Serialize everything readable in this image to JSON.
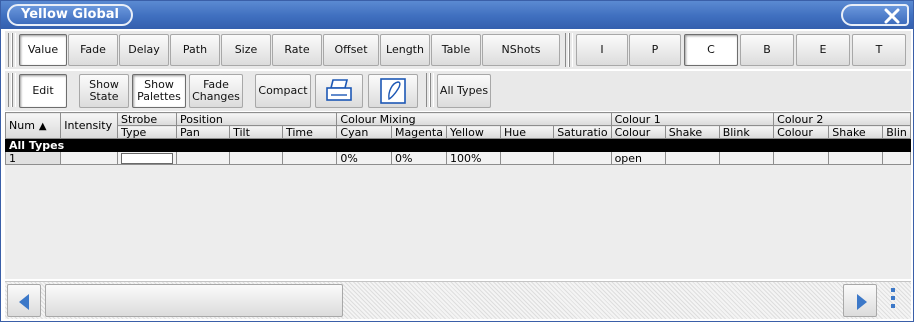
{
  "window": {
    "title": "Yellow Global"
  },
  "toolbar1": {
    "buttons": [
      "Value",
      "Fade",
      "Delay",
      "Path",
      "Size",
      "Rate",
      "Offset",
      "Length",
      "Table",
      "NShots"
    ],
    "attr_buttons": [
      "I",
      "P",
      "C",
      "B",
      "E",
      "T"
    ],
    "active_button": "Value",
    "active_attr": "C"
  },
  "toolbar2": {
    "edit": "Edit",
    "show_state": "Show State",
    "show_palettes": "Show Palettes",
    "fade_changes": "Fade Changes",
    "compact": "Compact",
    "print_icon": "printer-icon",
    "pen_icon": "pen-icon",
    "all_types": "All Types"
  },
  "table": {
    "group_headers": {
      "num": "Num",
      "intensity": "Intensity",
      "strobe": "Strobe",
      "position": "Position",
      "colour_mixing": "Colour Mixing",
      "colour1": "Colour 1",
      "colour2": "Colour 2"
    },
    "sub_headers": {
      "strobe_type": "Type",
      "pan": "Pan",
      "tilt": "Tilt",
      "time": "Time",
      "cyan": "Cyan",
      "magenta": "Magenta",
      "yellow": "Yellow",
      "hue": "Hue",
      "saturation": "Saturatio",
      "colour1_colour": "Colour",
      "colour1_shake": "Shake",
      "colour1_blink": "Blink",
      "colour2_colour": "Colour",
      "colour2_shake": "Shake",
      "colour2_blink": "Blin"
    },
    "section_label": "All Types",
    "rows": [
      {
        "num": "1",
        "intensity": "",
        "pan": "",
        "tilt": "",
        "time": "",
        "cyan": "0%",
        "magenta": "0%",
        "yellow": "100%",
        "hue": "",
        "saturation": "",
        "colour1": "open",
        "shake1": "",
        "blink1": "",
        "colour2": "",
        "shake2": "",
        "blink2": ""
      }
    ]
  },
  "colors": {
    "title_bar": "#3f6fbf",
    "accent_blue": "#3c78c8",
    "section_bg": "#000000"
  }
}
